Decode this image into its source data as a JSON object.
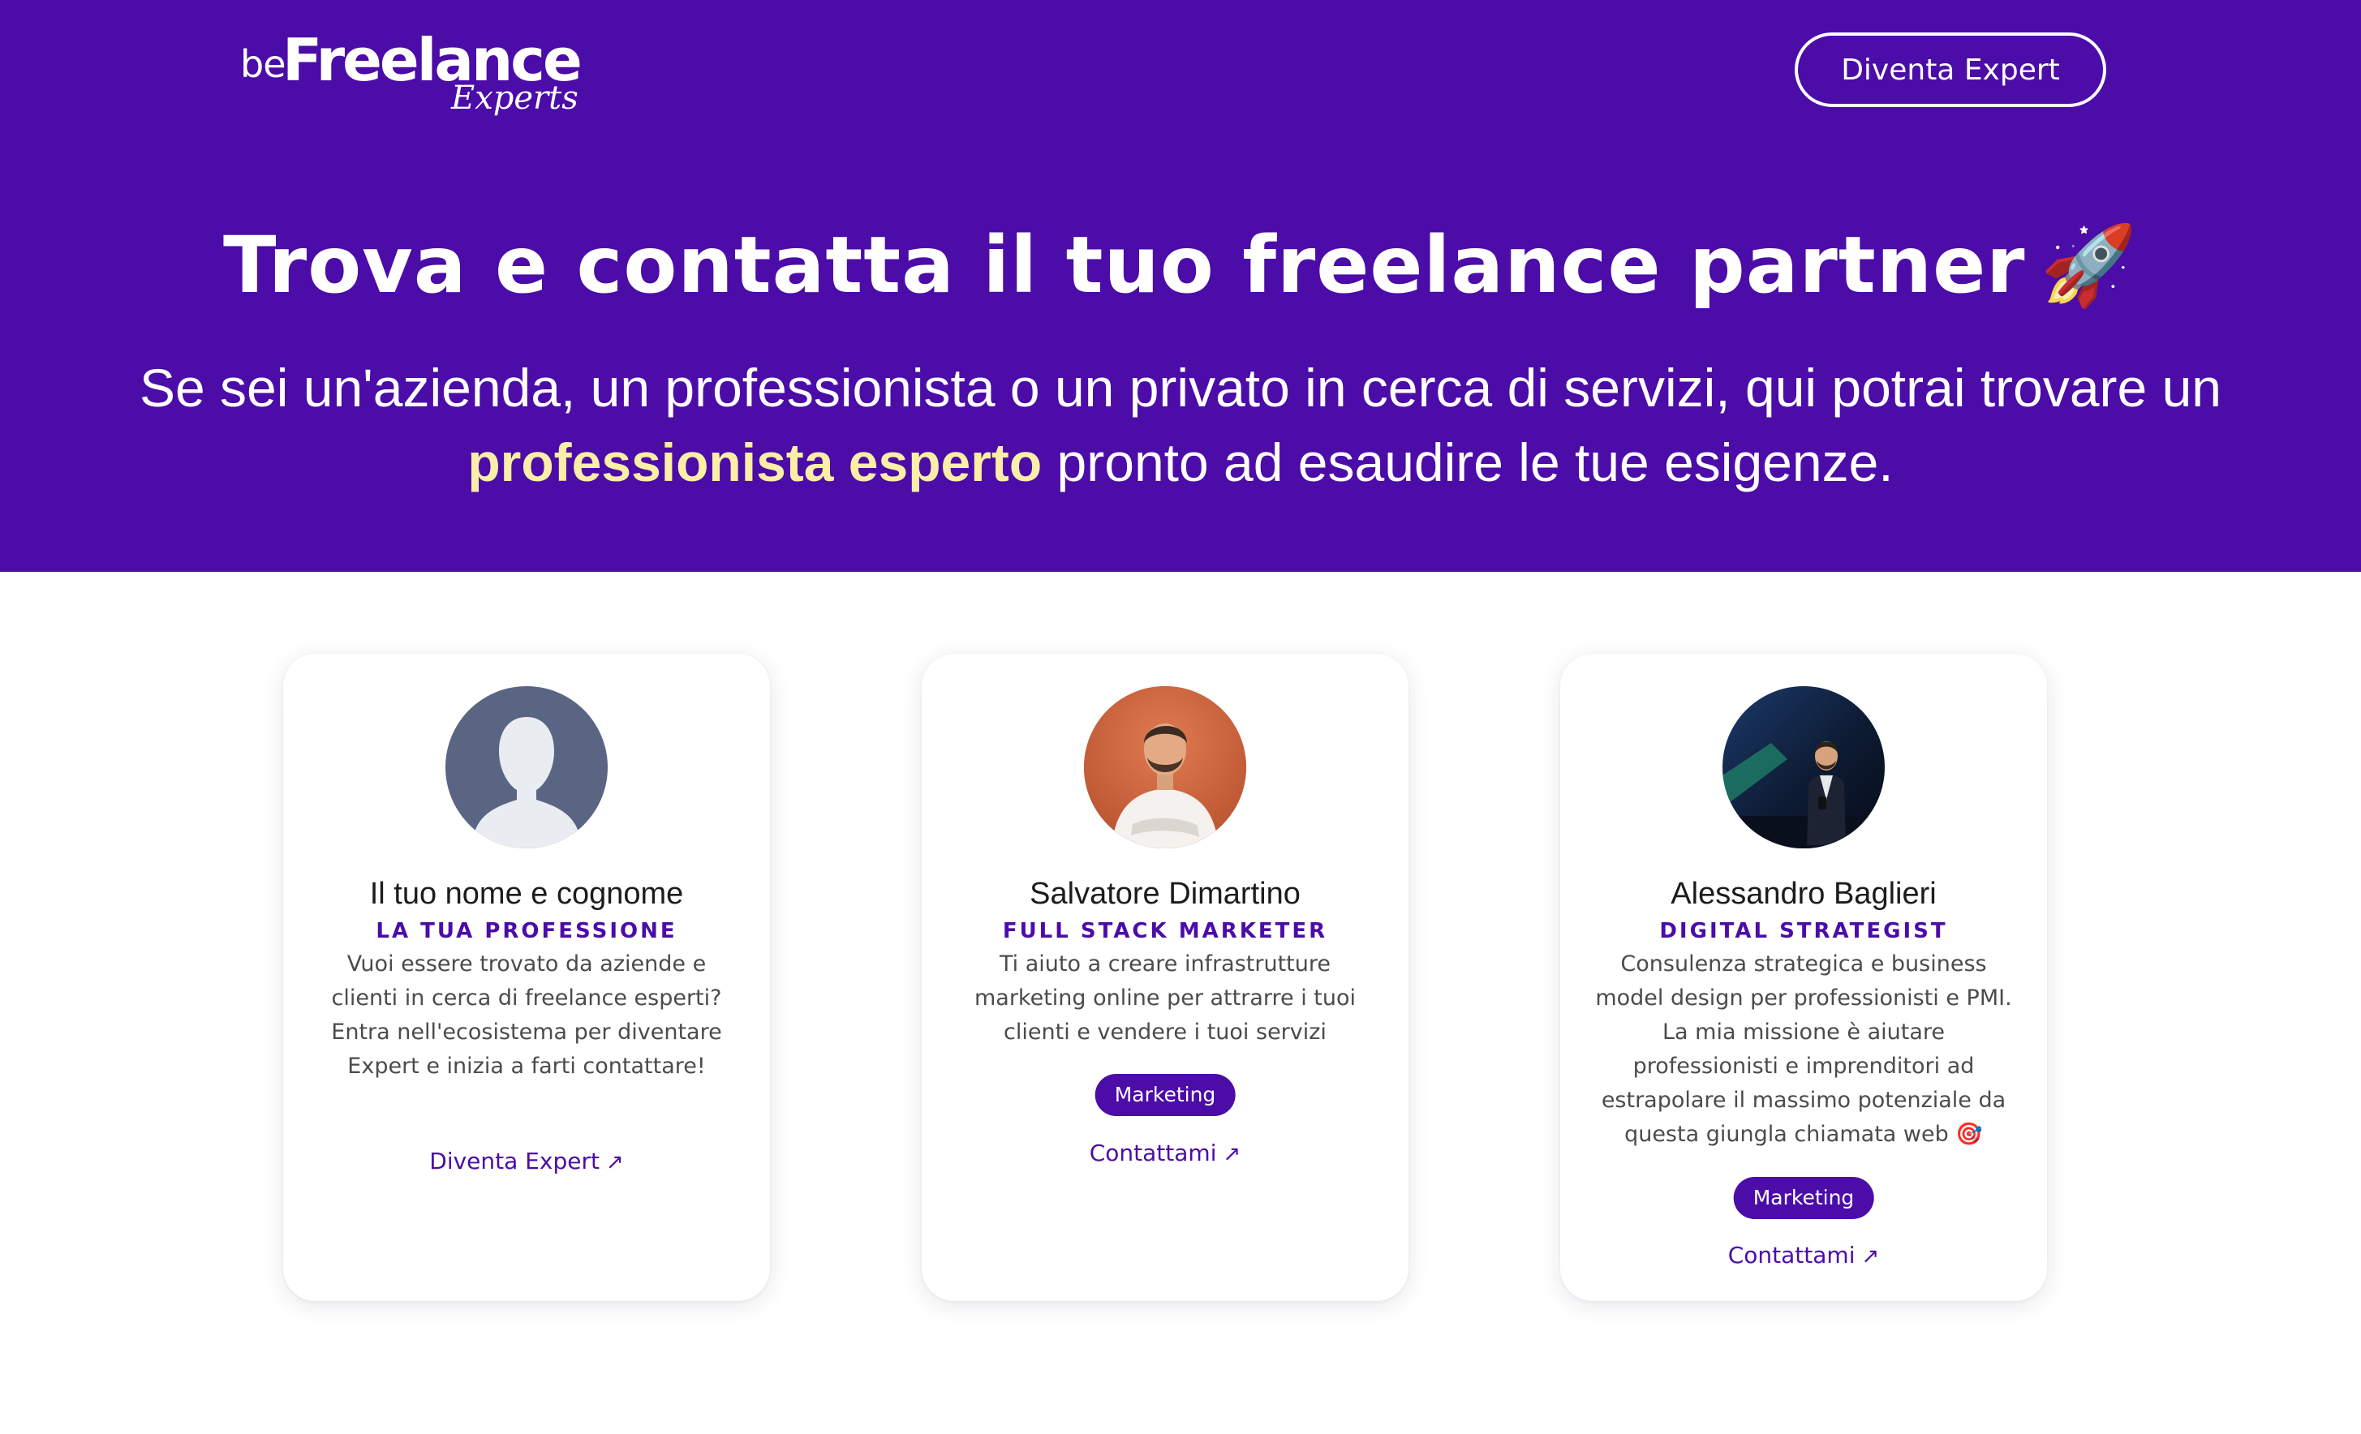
{
  "brand": {
    "logo_be": "be",
    "logo_freelance": "Freelance",
    "logo_experts": "Experts"
  },
  "header": {
    "cta_label": "Diventa Expert"
  },
  "hero": {
    "title": "Trova e contatta il tuo freelance partner",
    "title_emoji": "🚀",
    "subtitle_before": "Se sei un'azienda, un professionista o un privato in cerca di servizi, qui potrai trovare un ",
    "subtitle_highlight": "professionista esperto",
    "subtitle_after": " pronto ad esaudire le tue esigenze."
  },
  "cards": [
    {
      "name": "Il tuo nome e cognome",
      "role": "LA TUA PROFESSIONE",
      "description": "Vuoi essere trovato da aziende e clienti in cerca di freelance esperti? Entra nell'ecosistema per diventare Expert e inizia a farti contattare!",
      "link_label": "Diventa Expert",
      "link_arrow": "↗",
      "avatar": "placeholder-silhouette"
    },
    {
      "name": "Salvatore Dimartino",
      "role": "FULL STACK MARKETER",
      "description": "Ti aiuto a creare infrastrutture marketing online per attrarre i tuoi clienti e vendere i tuoi servizi",
      "tag": "Marketing",
      "link_label": "Contattami",
      "link_arrow": "↗",
      "avatar": "photo-orange-background"
    },
    {
      "name": "Alessandro Baglieri",
      "role": "DIGITAL STRATEGIST",
      "description": "Consulenza strategica e business model design per professionisti e PMI. La mia missione è aiutare professionisti e imprenditori ad estrapolare il massimo potenziale da questa giungla chiamata web 🎯",
      "tag": "Marketing",
      "link_label": "Contattami",
      "link_arrow": "↗",
      "avatar": "photo-dark-stage"
    }
  ],
  "colors": {
    "brand_purple": "#4b0ca8",
    "highlight_yellow": "#fbeea6",
    "white": "#ffffff"
  }
}
